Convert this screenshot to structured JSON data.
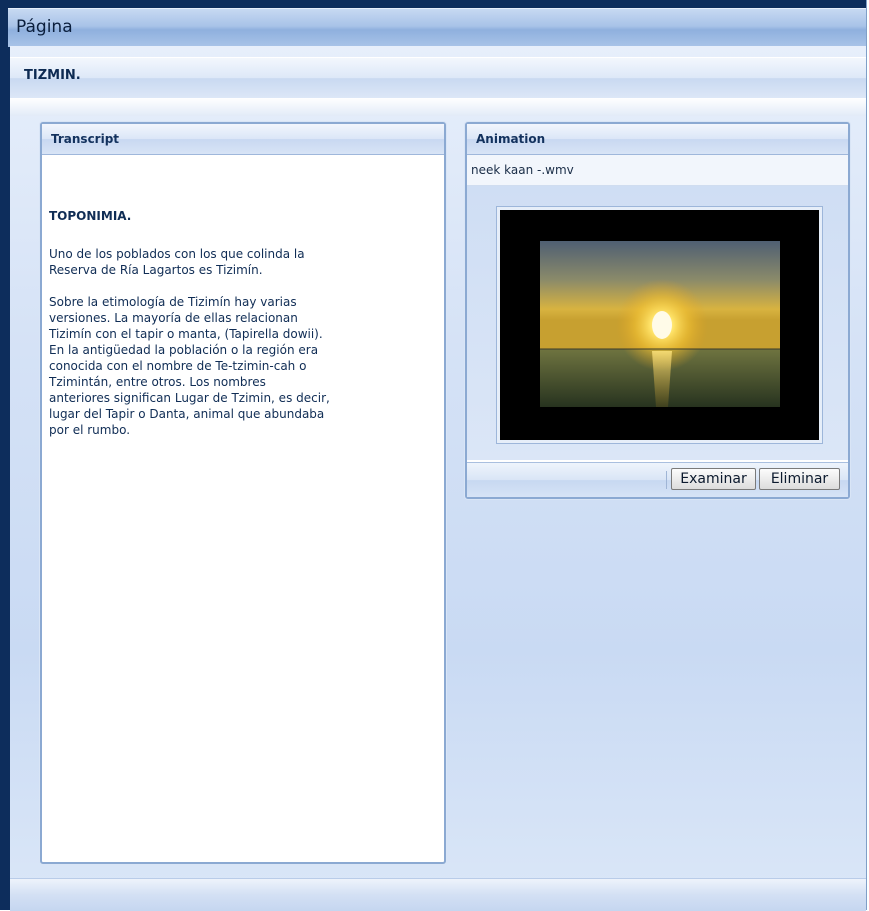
{
  "window": {
    "title": "Página"
  },
  "header": {
    "label": "TIZMIN."
  },
  "transcript": {
    "title": "Transcript",
    "heading": "TOPONIMIA.",
    "paragraph1": "Uno de los poblados con los que colinda la\nReserva de Ría Lagartos es Tizimín.",
    "paragraph2": "Sobre la etimología de Tizimín hay varias\nversiones. La mayoría de ellas relacionan\nTizimín con el tapir o manta, (Tapirella dowii).\nEn la antigüedad la población o la región era\nconocida con el nombre de Te-tzimin-cah o\nTzimintán, entre otros. Los nombres\nanteriores significan Lugar de Tzimin, es decir,\nlugar del Tapir o Danta, animal que abundaba\npor el rumbo."
  },
  "animation": {
    "title": "Animation",
    "filename": "neek kaan -.wmv",
    "thumbnail_icon": "sunset-thumbnail",
    "buttons": {
      "browse": "Examinar",
      "remove": "Eliminar"
    }
  },
  "colors": {
    "frame": "#0d2d5c",
    "panel_border": "#8ba9d2",
    "text": "#102d55"
  }
}
